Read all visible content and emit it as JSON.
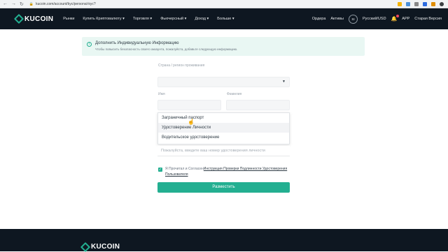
{
  "browser": {
    "url": "kucoin.com/account/kyc/personal-kyc?",
    "nav": [
      "←",
      "→",
      "↻"
    ]
  },
  "header": {
    "logo_text": "KUCOIN",
    "menu": [
      "Рынки",
      "Купить Криптовалюту",
      "Торговля",
      "Фьючерсный",
      "Доход",
      "Больше"
    ],
    "orders": "Ордера",
    "assets": "Активы",
    "avatar": "SI",
    "lang": "Русский/USD",
    "app": "APP",
    "old_version": "Старая Версия"
  },
  "notice": {
    "title": "Дополнить Индивидуальную Информацию",
    "subtitle": "Чтобы повысить безопасность своего аккаунта, пожалуйста, добавьте следующую информацию."
  },
  "form": {
    "country_label": "Страна / регион проживания",
    "first_name_label": "Имя",
    "last_name_label": "Фамилия",
    "id_placeholder": "Пожалуйста, введите ваш номер удостоверения личности",
    "doc_options": [
      "Заграничный паспорт",
      "Удостоверение Личности",
      "Водительское удостоверение"
    ],
    "agree_prefix": "Я Прочитал и Согласен",
    "agree_link": "Инструкция Проверки Подлинности Удостоверения Пользователя",
    "submit": "Разместить"
  },
  "footer": {
    "logo_text": "KUCOIN"
  },
  "colors": {
    "brand": "#23af91",
    "header_bg": "#0e1721"
  }
}
